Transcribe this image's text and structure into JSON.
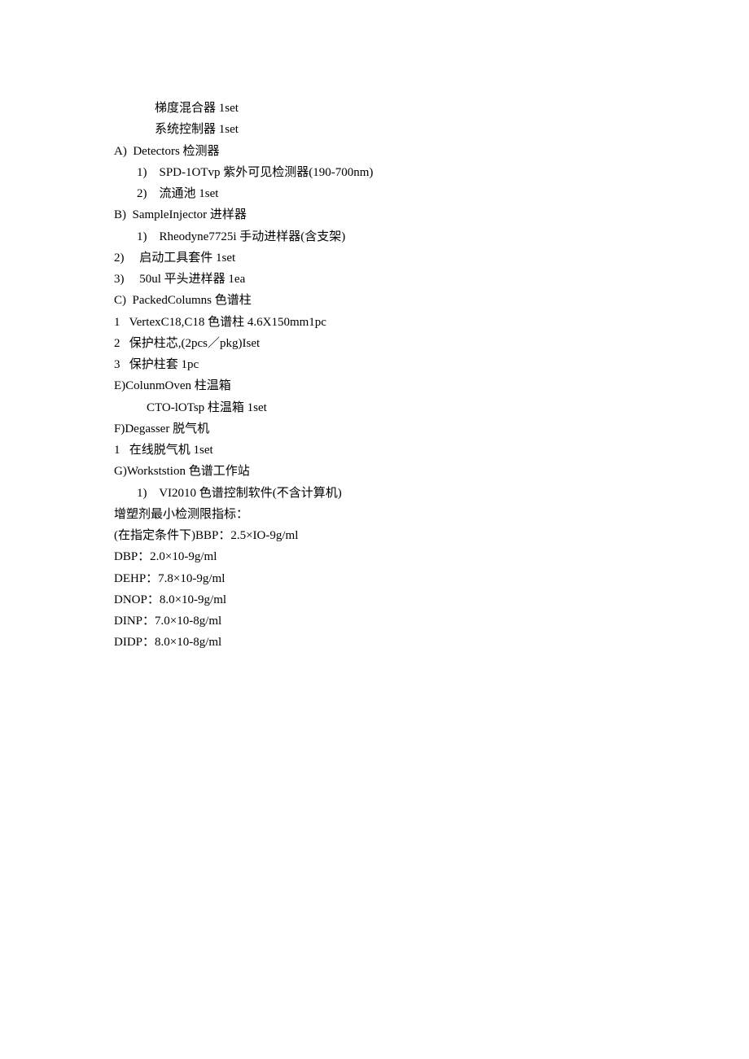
{
  "lines": [
    {
      "text": "梯度混合器 1set",
      "class": "indent-1"
    },
    {
      "text": "系统控制器 1set",
      "class": "indent-1"
    },
    {
      "text": "A)  Detectors 检测器",
      "class": "no-indent"
    },
    {
      "text": "1)    SPD-1OTvp 紫外可见检测器(190-700nm)",
      "class": "indent-2"
    },
    {
      "text": "2)    流通池 1set",
      "class": "indent-2"
    },
    {
      "text": "B)  SampleInjector 进样器",
      "class": "no-indent"
    },
    {
      "text": "1)    Rheodyne7725i 手动进样器(含支架)",
      "class": "indent-2"
    },
    {
      "text": "2)     启动工具套件 1set",
      "class": "no-indent"
    },
    {
      "text": "3)     50ul 平头进样器 1ea",
      "class": "no-indent"
    },
    {
      "text": "C)  PackedColumns 色谱柱",
      "class": "no-indent"
    },
    {
      "text": "1   VertexC18,C18 色谱柱 4.6X150mm1pc",
      "class": "no-indent"
    },
    {
      "text": "2   保护柱芯,(2pcs／pkg)Iset",
      "class": "no-indent"
    },
    {
      "text": "3   保护柱套 1pc",
      "class": "no-indent"
    },
    {
      "text": "E)ColunmOven 柱温箱",
      "class": "no-indent"
    },
    {
      "text": "CTO-lOTsp 柱温箱 1set",
      "class": "indent-3"
    },
    {
      "text": "F)Degasser 脱气机",
      "class": "no-indent"
    },
    {
      "text": "1   在线脱气机 1set",
      "class": "no-indent"
    },
    {
      "text": "G)Workststion 色谱工作站",
      "class": "no-indent"
    },
    {
      "text": "1)    VI2010 色谱控制软件(不含计算机)",
      "class": "indent-2"
    },
    {
      "text": "增塑剂最小检测限指标：",
      "class": "no-indent"
    },
    {
      "text": "(在指定条件下)BBP：2.5×IO-9g/ml",
      "class": "no-indent"
    },
    {
      "text": "DBP：2.0×10-9g/ml",
      "class": "no-indent"
    },
    {
      "text": "DEHP：7.8×10-9g/ml",
      "class": "no-indent"
    },
    {
      "text": "DNOP：8.0×10-9g/ml",
      "class": "no-indent"
    },
    {
      "text": "DINP：7.0×10-8g/ml",
      "class": "no-indent"
    },
    {
      "text": "DIDP：8.0×10-8g/ml",
      "class": "no-indent"
    }
  ]
}
